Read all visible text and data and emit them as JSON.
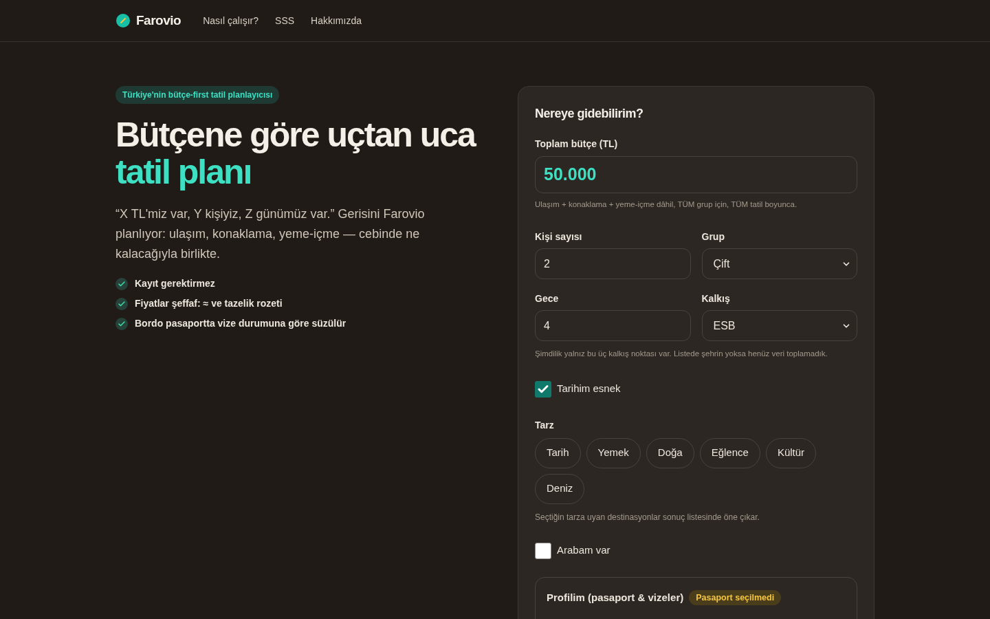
{
  "nav": {
    "brand": "Farovio",
    "links": [
      "Nasıl çalışır?",
      "SSS",
      "Hakkımızda"
    ]
  },
  "hero": {
    "badge": "Türkiye'nin bütçe-first tatil planlayıcısı",
    "headline": "Bütçene göre uçtan uca",
    "headline_accent": "tatil planı",
    "lead": "“X TL'miz var, Y kişiyiz, Z günümüz var.” Gerisini Farovio planlıyor: ulaşım, konaklama, yeme-içme — cebinde ne kalacağıyla birlikte.",
    "features": [
      "Kayıt gerektirmez",
      "Fiyatlar şeffaf: ≈ ve tazelik rozeti",
      "Bordo pasaportta vize durumuna göre süzülür"
    ]
  },
  "form": {
    "title": "Nereye gidebilirim?",
    "budget": {
      "label": "Toplam bütçe (TL)",
      "value": "50.000",
      "hint": "Ulaşım + konaklama + yeme-içme dâhil, TÜM grup için, TÜM tatil boyunca."
    },
    "fields": [
      {
        "kind": "input",
        "label": "Kişi sayısı",
        "value": "2"
      },
      {
        "kind": "select",
        "label": "Grup",
        "value": "Çift"
      },
      {
        "kind": "input",
        "label": "Gece",
        "value": "4"
      },
      {
        "kind": "select",
        "label": "Kalkış",
        "value": "ESB"
      }
    ],
    "fields_hint": "Şimdilik yalnız bu üç kalkış noktası var. Listede şehrin yoksa henüz veri toplamadık.",
    "flexible": {
      "label": "Tarihim esnek",
      "checked": true
    },
    "style": {
      "label": "Tarz",
      "chips": [
        {
          "label": "Tarih",
          "selected": false
        },
        {
          "label": "Yemek",
          "selected": false
        },
        {
          "label": "Doğa",
          "selected": false
        },
        {
          "label": "Eğlence",
          "selected": false
        },
        {
          "label": "Kültür",
          "selected": false
        },
        {
          "label": "Deniz",
          "selected": false
        }
      ],
      "hint": "Seçtiğin tarza uyan destinasyonlar sonuç listesinde öne çıkar."
    },
    "car": {
      "label": "Arabam var",
      "checked": false
    },
    "profile": {
      "title": "Profilim (pasaport & vizeler)",
      "badge": "Pasaport seçilmedi"
    }
  }
}
